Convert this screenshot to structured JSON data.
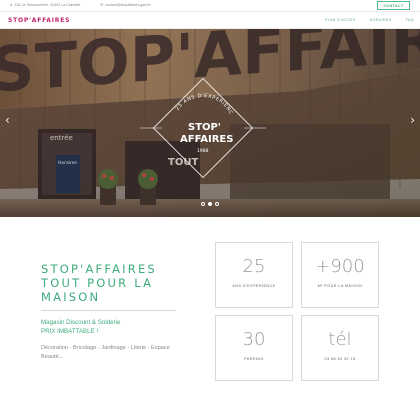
{
  "topbar": {
    "address": "ZAC la Tartasonnière, 30400 La Calmette",
    "email": "contact@stopaffaires-gard.fr",
    "contact_label": "CONTACT"
  },
  "header": {
    "logo": "STOP'AFFAIRES",
    "nav": [
      "PLAN D'ACCES",
      "HORAIRES",
      "FAQ"
    ]
  },
  "hero": {
    "store_sign": "STOP'AFFAIRES",
    "emblem_arc": "25 ANS D'EXPERIENCE",
    "emblem_title_1": "STOP'",
    "emblem_title_2": "AFFAIRES",
    "emblem_year": "1988",
    "door_sign": "entrée",
    "poster_title": "Horaires",
    "shop_sign": "TOUT",
    "slides_count": 3,
    "active_slide": 1
  },
  "intro": {
    "tagline": "STOP'AFFAIRES TOUT POUR LA MAISON",
    "subtitle_1": "Magasin Discount & Solderie",
    "subtitle_2": "PRIX IMBATTABLE !",
    "description": "Décoration - Bricolage - Jardinage - Literie - Espace Beauté..."
  },
  "tiles": [
    {
      "value": "25",
      "label": "ANS D'EXPERIENCE"
    },
    {
      "value": "+900",
      "label": "M² POUR LA MAISON"
    },
    {
      "value": "30",
      "label": "PARKING"
    },
    {
      "value": "tél",
      "label": "04 66 63 32 15"
    }
  ],
  "colors": {
    "accent_green": "#3dab7b",
    "logo_magenta": "#c1246b"
  }
}
